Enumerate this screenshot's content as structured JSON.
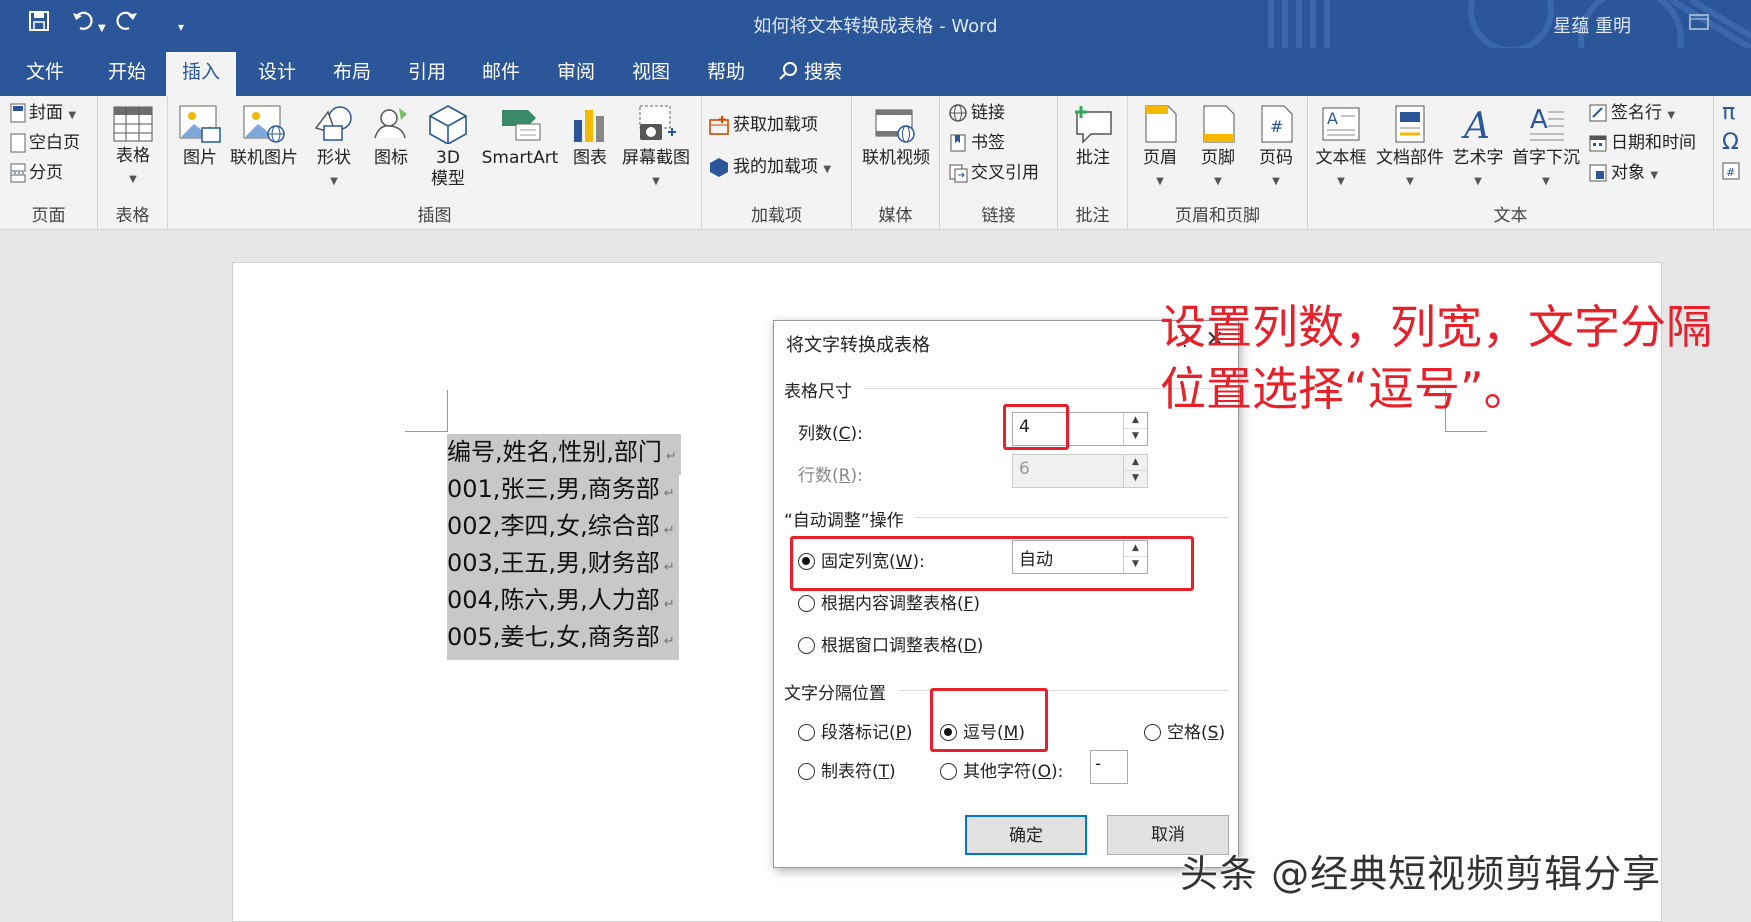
{
  "window": {
    "title": "如何将文本转换成表格 - Word",
    "user": "星蕴 重明"
  },
  "tabs": [
    "文件",
    "开始",
    "插入",
    "设计",
    "布局",
    "引用",
    "邮件",
    "审阅",
    "视图",
    "帮助",
    "搜索"
  ],
  "active_tab": "插入",
  "ribbon": {
    "pages": {
      "label": "页面",
      "cover": "封面",
      "blank": "空白页",
      "break": "分页"
    },
    "table": {
      "label": "表格",
      "btn": "表格"
    },
    "illus": {
      "label": "插图",
      "picture": "图片",
      "online_picture": "联机图片",
      "shapes": "形状",
      "icons": "图标",
      "model3d_a": "3D",
      "model3d_b": "模型",
      "smartart": "SmartArt",
      "chart": "图表",
      "screenshot": "屏幕截图"
    },
    "addins": {
      "label": "加载项",
      "get": "获取加载项",
      "mine": "我的加载项"
    },
    "media": {
      "label": "媒体",
      "video": "联机视频"
    },
    "links": {
      "label": "链接",
      "link": "链接",
      "bookmark": "书签",
      "xref": "交叉引用"
    },
    "comments": {
      "label": "批注",
      "comment": "批注"
    },
    "hf": {
      "label": "页眉和页脚",
      "header": "页眉",
      "footer": "页脚",
      "pagenum": "页码"
    },
    "text": {
      "label": "文本",
      "textbox": "文本框",
      "quickparts": "文档部件",
      "wordart": "艺术字",
      "dropcap": "首字下沉",
      "sigline": "签名行",
      "datetime": "日期和时间",
      "object": "对象"
    }
  },
  "document": {
    "lines": [
      "编号,姓名,性别,部门",
      "001,张三,男,商务部",
      "002,李四,女,综合部",
      "003,王五,男,财务部",
      "004,陈六,男,人力部",
      "005,姜七,女,商务部"
    ],
    "para_mark": "↵"
  },
  "dialog": {
    "title": "将文字转换成表格",
    "help": "?",
    "size_section": "表格尺寸",
    "cols_label": "列数(",
    "cols_key": "C",
    "cols_label_end": "):",
    "cols_value": "4",
    "rows_label": "行数(",
    "rows_key": "R",
    "rows_label_end": "):",
    "rows_value": "6",
    "autofit_section": "“自动调整”操作",
    "fixed": {
      "pre": "固定列宽(",
      "key": "W",
      "post": "):",
      "value": "自动"
    },
    "content": {
      "pre": "根据内容调整表格(",
      "key": "F",
      "post": ")"
    },
    "window": {
      "pre": "根据窗口调整表格(",
      "key": "D",
      "post": ")"
    },
    "sep_section": "文字分隔位置",
    "para": {
      "pre": "段落标记(",
      "key": "P",
      "post": ")"
    },
    "comma": {
      "pre": "逗号(",
      "key": "M",
      "post": ")"
    },
    "space": {
      "pre": "空格(",
      "key": "S",
      "post": ")"
    },
    "tab": {
      "pre": "制表符(",
      "key": "T",
      "post": ")"
    },
    "other": {
      "pre": "其他字符(",
      "key": "O",
      "post": "):",
      "value": "-"
    },
    "ok": "确定",
    "cancel": "取消"
  },
  "annotation": {
    "line1": "设置列数，列宽，文字分隔",
    "line2": "位置选择“逗号”。"
  },
  "watermark": "头条 @经典短视频剪辑分享",
  "colors": {
    "accent": "#2b579a",
    "annotation": "#e8202a"
  }
}
